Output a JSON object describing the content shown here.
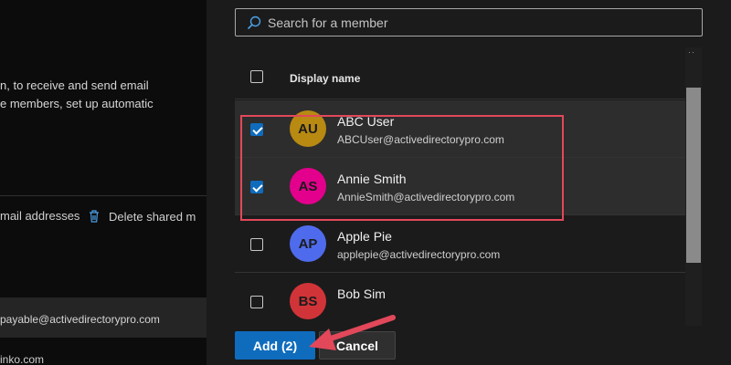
{
  "background": {
    "description_lines": [
      "n, to receive and send email",
      "e members, set up automatic"
    ],
    "actions": {
      "email_addresses": "mail addresses",
      "delete_shared": "Delete shared m"
    },
    "row_email": "payable@activedirectorypro.com",
    "bottom_text": "inko.com"
  },
  "search": {
    "placeholder": "Search for a member"
  },
  "list": {
    "header": "Display name",
    "members": [
      {
        "initials": "AU",
        "name": "ABC User",
        "email": "ABCUser@activedirectorypro.com",
        "avatar_color": "#b88a12",
        "checked": true
      },
      {
        "initials": "AS",
        "name": "Annie Smith",
        "email": "AnnieSmith@activedirectorypro.com",
        "avatar_color": "#e3008c",
        "checked": true
      },
      {
        "initials": "AP",
        "name": "Apple Pie",
        "email": "applepie@activedirectorypro.com",
        "avatar_color": "#4f6bed",
        "checked": false
      },
      {
        "initials": "BS",
        "name": "Bob Sim",
        "email": "",
        "avatar_color": "#d13438",
        "checked": false
      }
    ]
  },
  "footer": {
    "add_label": "Add (2)",
    "cancel_label": "Cancel"
  },
  "colors": {
    "accent": "#0f6cbd",
    "highlight": "#e2485a"
  }
}
